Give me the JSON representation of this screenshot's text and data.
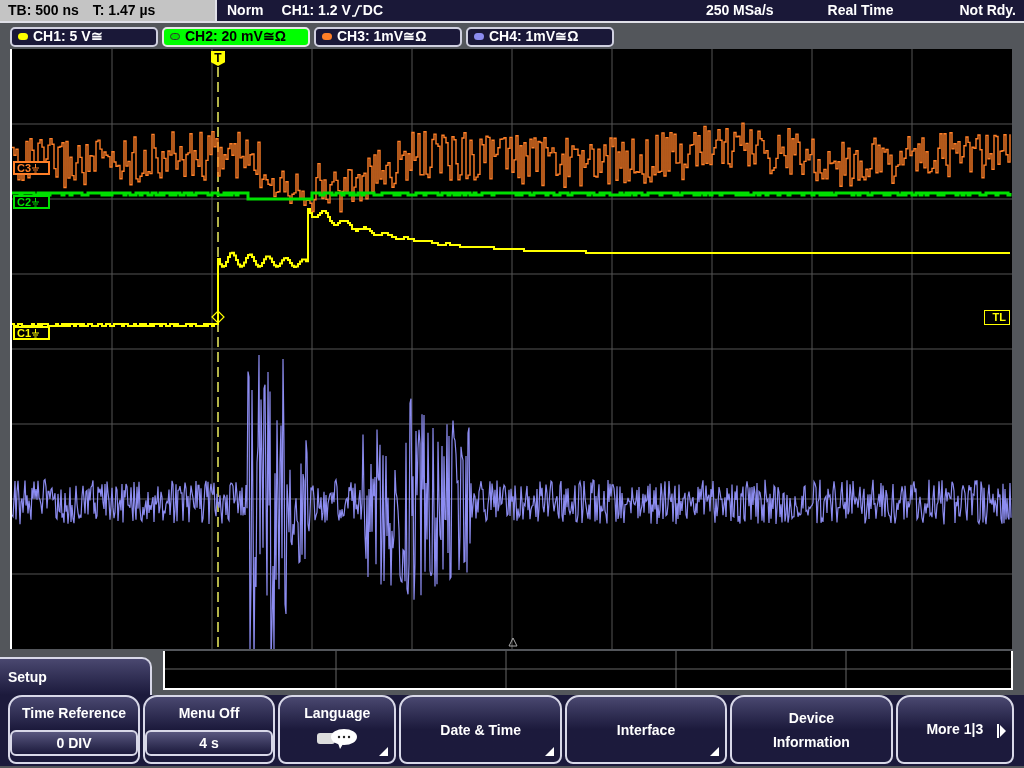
{
  "status_bar": {
    "timebase": "TB: 500 ns",
    "trigger_time": "T: 1.47 µs",
    "mode": "Norm",
    "trigger_level": "CH1: 1.2 V",
    "trigger_coupling": "DC",
    "sample_rate": "250 MSa/s",
    "acquisition": "Real Time",
    "state": "Not Rdy."
  },
  "channels": [
    {
      "label": "CH1: 5 V≅",
      "color": "#ffff00",
      "selected": false
    },
    {
      "label": "CH2: 20 mV≅Ω",
      "color": "#00e000",
      "selected": true
    },
    {
      "label": "CH3: 1mV≅Ω",
      "color": "#ff7f27",
      "selected": false
    },
    {
      "label": "CH4: 1mV≅Ω",
      "color": "#8c8cf0",
      "selected": false
    }
  ],
  "screen": {
    "trigger_marker": "T",
    "trigger_level_marker": "TL",
    "channel_markers": [
      {
        "label": "C3",
        "color": "#ff7f27"
      },
      {
        "label": "C2",
        "color": "#00e000"
      },
      {
        "label": "C1",
        "color": "#ffff00"
      }
    ]
  },
  "menu": {
    "title": "Setup",
    "softkeys": [
      {
        "kind": "value",
        "label": "Time Reference",
        "value": "0 DIV"
      },
      {
        "kind": "value",
        "label": "Menu Off",
        "value": "4 s"
      },
      {
        "kind": "icon",
        "label": "Language",
        "submenu": true
      },
      {
        "kind": "plain",
        "label": "Date & Time",
        "submenu": true
      },
      {
        "kind": "plain",
        "label": "Interface",
        "submenu": true
      },
      {
        "kind": "plain",
        "label": "Device Information",
        "submenu": false
      },
      {
        "kind": "more",
        "label": "More 1|3"
      }
    ]
  }
}
